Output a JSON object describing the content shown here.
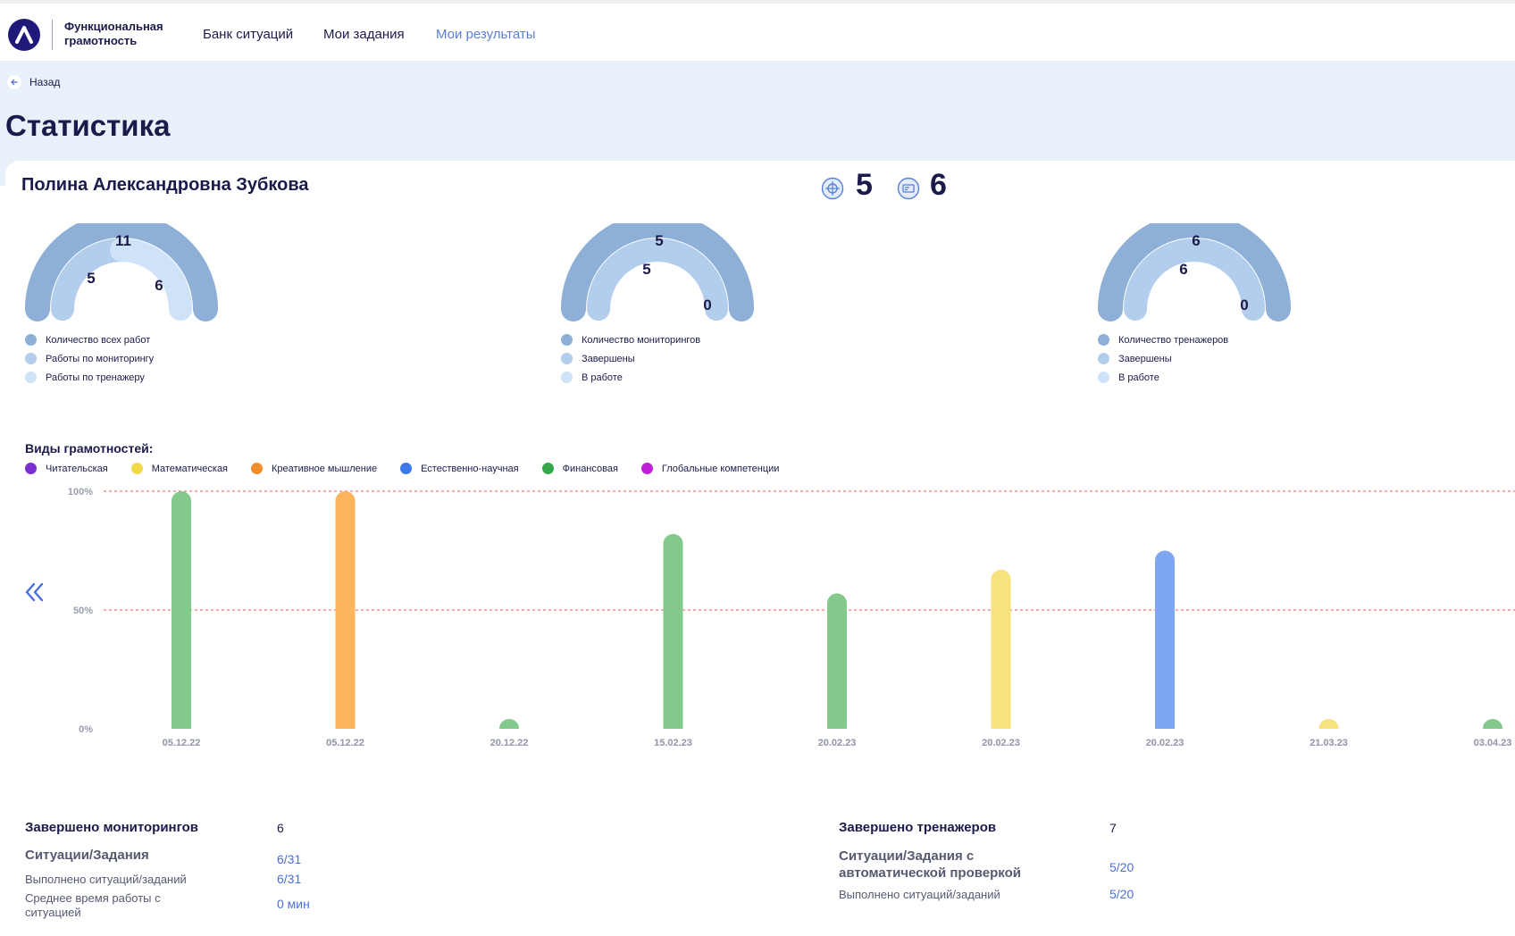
{
  "brand": {
    "name": "Функциональная грамотность"
  },
  "nav": [
    {
      "label": "Банк ситуаций",
      "active": false
    },
    {
      "label": "Мои задания",
      "active": false
    },
    {
      "label": "Мои результаты",
      "active": true
    }
  ],
  "back_label": "Назад",
  "page_title": "Статистика",
  "student": {
    "name": "Полина Александровна Зубкова",
    "summary": [
      {
        "icon": "target-icon",
        "value": "5"
      },
      {
        "icon": "trainer-icon",
        "value": "6"
      }
    ]
  },
  "gauges": [
    {
      "outer": "11",
      "inner_left": "5",
      "inner_right": "6",
      "legend": [
        "Количество всех работ",
        "Работы по мониторингу",
        "Работы по тренажеру"
      ]
    },
    {
      "outer": "5",
      "inner_left": "5",
      "inner_right": "0",
      "legend": [
        "Количество мониторингов",
        "Завершены",
        "В работе"
      ]
    },
    {
      "outer": "6",
      "inner_left": "6",
      "inner_right": "0",
      "legend": [
        "Количество тренажеров",
        "Завершены",
        "В работе"
      ]
    }
  ],
  "colors": {
    "gauge_outer": "#8eafd6",
    "gauge_mid": "#b3cdec",
    "gauge_inner": "#cfe3f8",
    "accent": "#4a6fdc",
    "title": "#1b1b4b"
  },
  "literacy": {
    "title": "Виды грамотностей:",
    "types": [
      {
        "label": "Читательская",
        "color": "#7b2fd0"
      },
      {
        "label": "Математическая",
        "color": "#f2d94a"
      },
      {
        "label": "Креативное мышление",
        "color": "#f28c28"
      },
      {
        "label": "Естественно-научная",
        "color": "#3f78e8"
      },
      {
        "label": "Финансовая",
        "color": "#35a84a"
      },
      {
        "label": "Глобальные компетенции",
        "color": "#c21fd9"
      }
    ]
  },
  "chart_data": {
    "type": "bar",
    "ylim": [
      0,
      100
    ],
    "yticks": [
      "0%",
      "50%",
      "100%"
    ],
    "reference_lines": [
      50,
      100
    ],
    "categories": [
      "05.12.22",
      "05.12.22",
      "20.12.22",
      "15.02.23",
      "20.02.23",
      "20.02.23",
      "20.02.23",
      "21.03.23",
      "03.04.23"
    ],
    "values": [
      100,
      100,
      3,
      82,
      57,
      67,
      75,
      3,
      3
    ],
    "bar_colors": [
      "#82c98b",
      "#fbb55c",
      "#82c98b",
      "#82c98b",
      "#82c98b",
      "#f8e27e",
      "#7fa6f4",
      "#f8e27e",
      "#82c98b"
    ]
  },
  "stats_left": {
    "head_label": "Завершено мониторингов",
    "head_value": "6",
    "sub_label": "Ситуации/Задания",
    "sub_value": "6/31",
    "row1_label": "Выполнено ситуаций/заданий",
    "row1_value": "6/31",
    "row2_label": "Среднее время работы с ситуацией",
    "row2_value": "0 мин"
  },
  "stats_right": {
    "head_label": "Завершено тренажеров",
    "head_value": "7",
    "sub_label": "Ситуации/Задания с автоматической проверкой",
    "sub_value": "5/20",
    "row1_label": "Выполнено ситуаций/заданий",
    "row1_value": "5/20"
  }
}
